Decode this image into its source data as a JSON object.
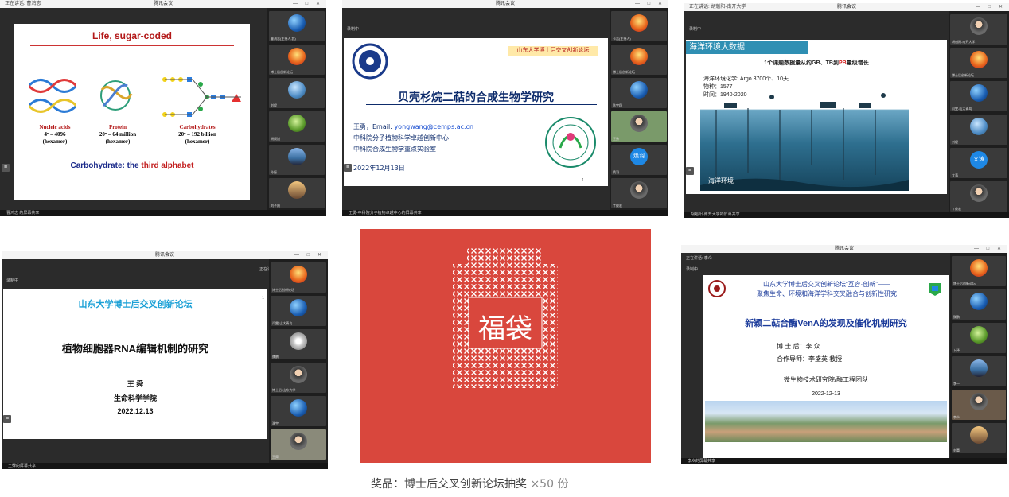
{
  "panel1": {
    "window_title": "腾讯会议",
    "status": "正在讲话: 曹鸿志",
    "window_controls": "— □ ✕",
    "slide": {
      "title": "Life, sugar-coded",
      "labels": [
        {
          "name": "Nucleic acids",
          "formula": "4ⁿ – 4096",
          "unit": "(hexamer)"
        },
        {
          "name": "Protein",
          "formula": "20ⁿ – 64 million",
          "unit": "(hexamer)"
        },
        {
          "name": "Carbohydrates",
          "formula": "20ⁿ – 192 billion",
          "unit": "(hexamer)"
        }
      ],
      "bottom_prefix": "Carbohydrate: the ",
      "bottom_highlight": "third alphabet"
    },
    "participants": [
      "曹鸿志(主持人,我)",
      "博士后创新论坛",
      "刘程",
      "胡辰旭",
      "孙振",
      "刘子阳"
    ],
    "footer": "曹鸿志 的屏幕共享"
  },
  "panel2": {
    "window_title": "腾讯会议",
    "window_controls": "— □ ✕",
    "recording": "录制中",
    "slide": {
      "forum": "山东大学博士后交叉创新论坛",
      "title": "贝壳杉烷二萜的合成生物学研究",
      "author_prefix": "王勇，Email: ",
      "email": "yongwang@cemps.ac.cn",
      "affiliation1": "中科院分子植物科学卓越创新中心",
      "affiliation2": "中科院合成生物学重点实验室",
      "date": "2022年12月13日",
      "page": "1"
    },
    "participants": [
      "卡吉(主持人)",
      "博士后创新论坛",
      "陈宇翔",
      "王勇",
      "焕羽",
      "丁俊宏"
    ],
    "footer": "王勇-中科院分子植物卓越中心的屏幕共享"
  },
  "panel3": {
    "window_title": "腾讯会议",
    "status": "正在讲话: 胡魁阳-南开大学",
    "window_controls": "— □ ✕",
    "recording": "录制中",
    "slide": {
      "heading": "海洋环境大数据",
      "subtitle_prefix": "1个课题数据量从约GB、TB到",
      "subtitle_highlight": "PB",
      "subtitle_suffix": "量级增长",
      "line1": "海洋环境化学: Argo 3700个、10天",
      "line2": "物种：1577",
      "line3": "时间：1940-2020",
      "caption": "海洋环境"
    },
    "participants": [
      "胡魁阳-南开大学",
      "博士后创新论坛",
      "闫雯-山大青岛",
      "刘程",
      "文涛",
      "丁俊宏"
    ],
    "footer": "胡魁阳-南开大学的屏幕共享"
  },
  "panel4": {
    "window_title": "腾讯会议",
    "status": "正在讲话: 王勇",
    "window_controls": "— □ ✕",
    "recording": "录制中",
    "slide": {
      "forum": "山东大学博士后交叉创新论坛",
      "title": "植物细胞器RNA编辑机制的研究",
      "author": "王 舜",
      "college": "生命科学学院",
      "date": "2022.12.13",
      "page": "1"
    },
    "participants": [
      "博士后创新论坛",
      "闫雯-山大青岛",
      "魏鹏",
      "博士后-山东大学",
      "潘宇",
      "王舜"
    ],
    "footer": "王舜的屏幕共享"
  },
  "lucky_bag": {
    "label": "福袋",
    "prize_label": "奖品：",
    "prize_text": "博士后交叉创新论坛抽奖",
    "quantity": "×50 份"
  },
  "panel5": {
    "window_title": "腾讯会议",
    "status": "正在讲话: 李众",
    "window_controls": "— □ ✕",
    "recording": "录制中",
    "slide": {
      "header_line1": "山东大学博士后交叉创新论坛“互容·创新”——",
      "header_line2": "聚焦生命、环境和海洋学科交叉融合与创新性研究",
      "title": "新颖二萜合酶VenA的发现及催化机制研究",
      "postdoc": "博 士 后：李  众",
      "advisor": "合作导师：李盛英  教授",
      "institute": "微生物技术研究院/酶工程团队",
      "date": "2022-12-13"
    },
    "participants": [
      "博士后创新论坛",
      "魏鹏",
      "卜泽",
      "李一",
      "李众",
      "刘蕾"
    ],
    "footer": "李众的屏幕共享"
  }
}
